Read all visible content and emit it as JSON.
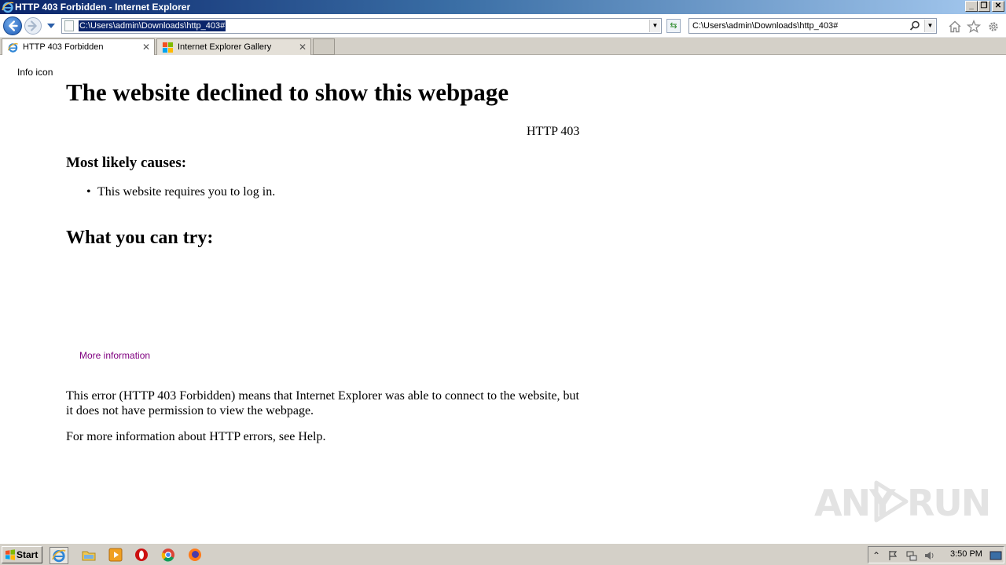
{
  "window": {
    "title": "HTTP 403 Forbidden - Internet Explorer",
    "minimize": "_",
    "restore": "❐",
    "close": "✕"
  },
  "address_bar": {
    "url": "C:\\Users\\admin\\Downloads\\http_403#",
    "dropdown": "▼"
  },
  "search_bar": {
    "value": "C:\\Users\\admin\\Downloads\\http_403#",
    "dropdown": "▼"
  },
  "refresh_glyph": "⇆",
  "tabs": [
    {
      "label": "HTTP 403 Forbidden",
      "close": "✕",
      "active": true
    },
    {
      "label": "Internet Explorer Gallery",
      "close": "✕",
      "active": false
    }
  ],
  "page": {
    "info_icon_alt": "Info icon",
    "title": "The website declined to show this webpage",
    "http_code": "HTTP 403",
    "causes_heading": "Most likely causes:",
    "causes": [
      "This website requires you to log in."
    ],
    "bullet": "•",
    "try_heading": "What you can try:",
    "more_info": "More information",
    "explanation": "This error (HTTP 403 Forbidden) means that Internet Explorer was able to connect to the website, but it does not have permission to view the webpage.",
    "help": "For more information about HTTP errors, see Help."
  },
  "watermark": {
    "left": "ANY",
    "right": "RUN"
  },
  "taskbar": {
    "start_label": "Start",
    "clock": "3:50 PM",
    "tray_up": "⌃"
  },
  "colors": {
    "titlebar_dark": "#0a246a",
    "titlebar_light": "#a6caf0",
    "chrome_gray": "#d4d0c8",
    "visited_link": "#800080",
    "selection": "#0a246a"
  }
}
